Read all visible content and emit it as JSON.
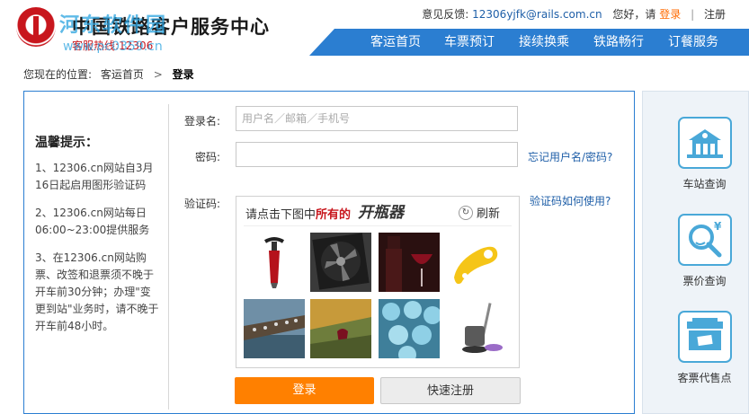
{
  "header": {
    "title": "中国铁路客户服务中心",
    "hotline": "客服热线:12306",
    "watermark_title": "河东软件园",
    "watermark_url": "www.pc0359.cn",
    "feedback_label": "意见反馈:",
    "feedback_email": "12306yjfk@rails.com.cn",
    "greeting": "您好，请",
    "login_link": "登录",
    "register_link": "注册"
  },
  "nav": {
    "items": [
      "客运首页",
      "车票预订",
      "接续换乘",
      "铁路畅行",
      "订餐服务"
    ]
  },
  "breadcrumb": {
    "prefix": "您现在的位置:",
    "home": "客运首页",
    "separator": ">",
    "current": "登录"
  },
  "tips": {
    "title": "温馨提示：",
    "items": [
      "1、12306.cn网站自3月16日起启用图形验证码",
      "2、12306.cn网站每日06:00~23:00提供服务",
      "3、在12306.cn网站购票、改签和退票须不晚于开车前30分钟；办理\"变更到站\"业务时，请不晚于开车前48小时。"
    ]
  },
  "form": {
    "username_label": "登录名:",
    "username_placeholder": "用户名／邮箱／手机号",
    "password_label": "密码:",
    "password_value": "",
    "forgot_link": "忘记用户名/密码?",
    "captcha_label": "验证码:",
    "captcha_help_link": "验证码如何使用?",
    "login_button": "登录",
    "quick_register_button": "快速注册"
  },
  "captcha": {
    "prompt_prefix": "请点击下图中",
    "prompt_highlight": "所有的",
    "target_word": "开瓶器",
    "refresh_label": "刷新",
    "images": [
      "corkscrew",
      "fan",
      "wine-bottle-glass",
      "bottle-opener",
      "boat-crowd",
      "vineyard",
      "blue-balls",
      "mop"
    ]
  },
  "sidebar": {
    "items": [
      {
        "label": "车站查询",
        "icon": "station-icon"
      },
      {
        "label": "票价查询",
        "icon": "price-search-icon"
      },
      {
        "label": "客票代售点",
        "icon": "ticket-agent-icon"
      }
    ]
  },
  "colors": {
    "brand_red": "#c8161d",
    "nav_blue": "#2b7ed1",
    "login_orange": "#ff8000",
    "link_blue": "#1f5fa8"
  }
}
